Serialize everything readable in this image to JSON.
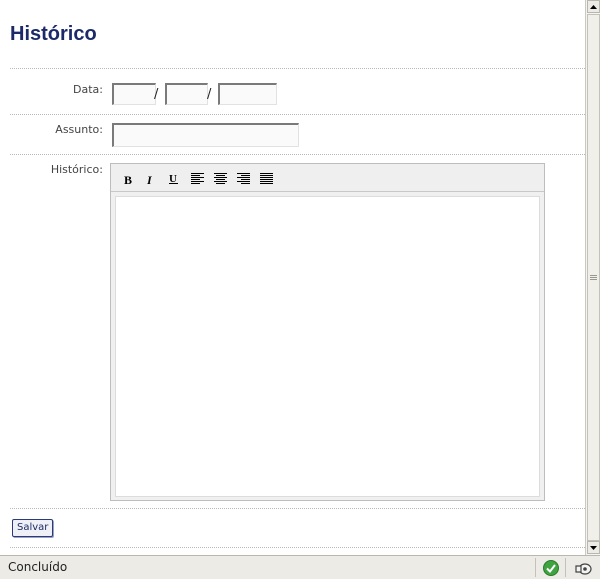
{
  "page": {
    "title": "Histórico"
  },
  "form": {
    "data_label": "Data",
    "date_separator": "/",
    "day_value": "",
    "month_value": "",
    "year_value": "",
    "assunto_label": "Assunto",
    "assunto_value": "",
    "historico_label": "Histórico",
    "label_suffix": ":",
    "save_label": "Salvar"
  },
  "editor": {
    "toolbar": [
      {
        "name": "bold-button",
        "icon": "bold-icon",
        "glyph": "B"
      },
      {
        "name": "italic-button",
        "icon": "italic-icon",
        "glyph": "I"
      },
      {
        "name": "underline-button",
        "icon": "underline-icon",
        "glyph": "U"
      },
      {
        "name": "align-left-button",
        "icon": "align-left-icon"
      },
      {
        "name": "align-center-button",
        "icon": "align-center-icon"
      },
      {
        "name": "align-right-button",
        "icon": "align-right-icon"
      },
      {
        "name": "justify-button",
        "icon": "justify-icon"
      }
    ],
    "content": ""
  },
  "statusbar": {
    "text": "Concluído",
    "icons": [
      "check-icon",
      "security-icon"
    ],
    "check_color": "#3fa33f"
  },
  "colors": {
    "title": "#1c2a6a",
    "button_text": "#1c2a6a"
  }
}
